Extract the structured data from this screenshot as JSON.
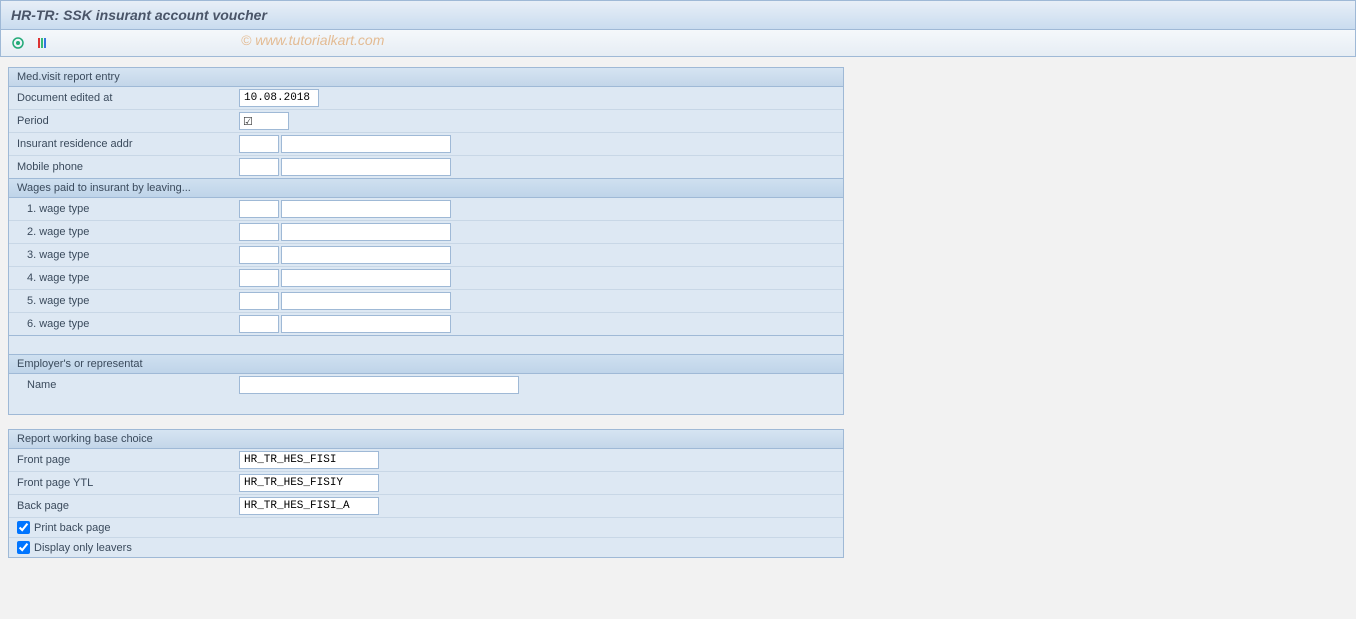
{
  "title": "HR-TR: SSK insurant account voucher",
  "watermark": "© www.tutorialkart.com",
  "toolbar": {
    "execute_icon": "execute",
    "variant_icon": "variant"
  },
  "panels": {
    "med_visit": {
      "header": "Med.visit report entry",
      "fields": {
        "doc_edited_label": "Document edited at",
        "doc_edited_value": "10.08.2018",
        "period_label": "Period",
        "period_checked": true,
        "residence_label": "Insurant residence addr",
        "residence_code": "",
        "residence_desc": "",
        "mobile_label": "Mobile phone",
        "mobile_code": "",
        "mobile_desc": ""
      },
      "wages": {
        "header": "Wages paid to insurant by leaving...",
        "rows": [
          {
            "label": "1. wage type",
            "code": "",
            "desc": ""
          },
          {
            "label": "2. wage type",
            "code": "",
            "desc": ""
          },
          {
            "label": "3. wage type",
            "code": "",
            "desc": ""
          },
          {
            "label": "4. wage type",
            "code": "",
            "desc": ""
          },
          {
            "label": "5. wage type",
            "code": "",
            "desc": ""
          },
          {
            "label": "6. wage type",
            "code": "",
            "desc": ""
          }
        ]
      },
      "employer": {
        "header": "Employer's or representat",
        "name_label": "Name",
        "name_value": ""
      }
    },
    "report_base": {
      "header": "Report working base choice",
      "front_page_label": "Front page",
      "front_page_value": "HR_TR_HES_FISI",
      "front_page_ytl_label": "Front page YTL",
      "front_page_ytl_value": "HR_TR_HES_FISIY",
      "back_page_label": "Back page",
      "back_page_value": "HR_TR_HES_FISI_A",
      "print_back_label": "Print back page",
      "print_back_checked": true,
      "display_leavers_label": "Display only leavers",
      "display_leavers_checked": true
    }
  }
}
